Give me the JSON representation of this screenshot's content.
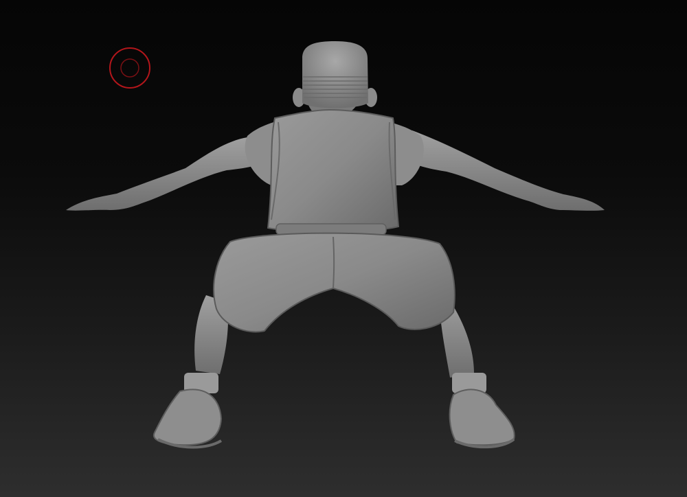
{
  "canvas": {
    "background_top": "#050505",
    "background_bottom": "#2e2e2e"
  },
  "brush_cursor": {
    "icon": "brush-cursor-icon",
    "color": "#b3161b"
  },
  "model": {
    "icon": "sculpt-model",
    "surface_color": "#8c8c8c"
  }
}
